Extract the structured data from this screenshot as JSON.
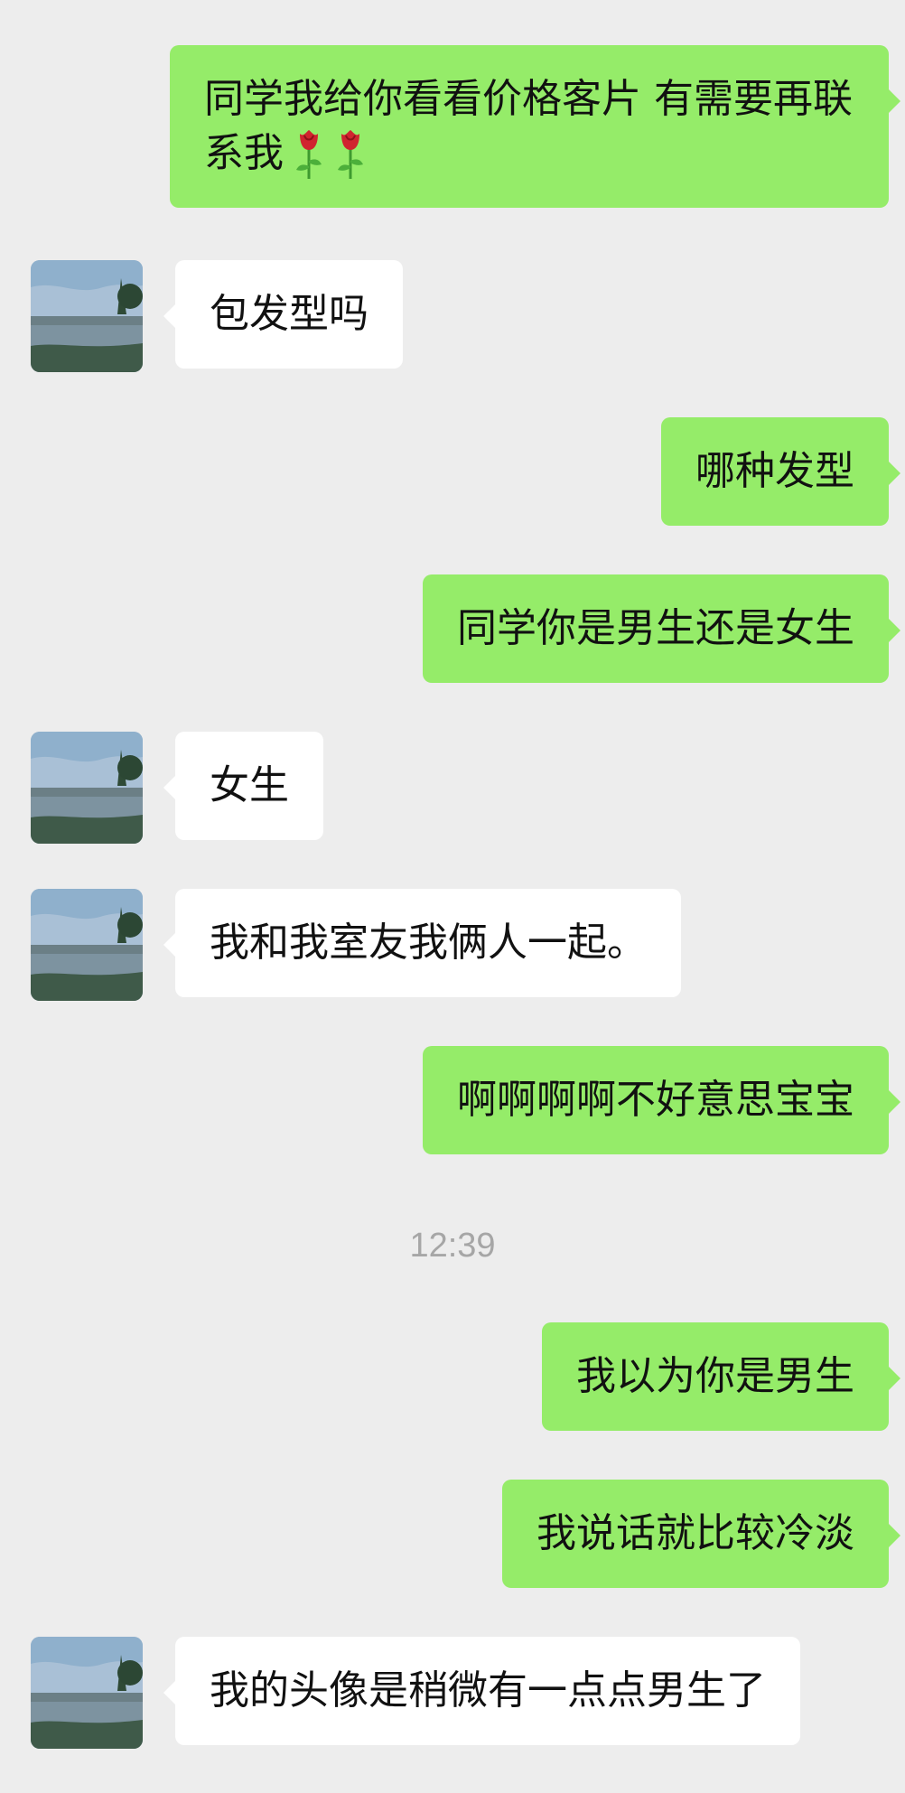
{
  "messages": [
    {
      "side": "right",
      "text": "同学我给你看看价格客片 有需要再联系我",
      "emoji": [
        "rose-icon",
        "rose-icon"
      ]
    },
    {
      "side": "left",
      "text": "包发型吗"
    },
    {
      "side": "right",
      "text": "哪种发型"
    },
    {
      "side": "right",
      "text": "同学你是男生还是女生"
    },
    {
      "side": "left",
      "text": "女生"
    },
    {
      "side": "left",
      "text": "我和我室友我俩人一起。"
    },
    {
      "side": "right",
      "text": "啊啊啊啊不好意思宝宝"
    },
    {
      "side": "right",
      "text": "我以为你是男生"
    },
    {
      "side": "right",
      "text": "我说话就比较冷淡"
    },
    {
      "side": "left",
      "text": "我的头像是稍微有一点点男生了"
    }
  ],
  "timestamp": "12:39",
  "colors": {
    "background": "#ededed",
    "outgoing_bubble": "#95ec69",
    "incoming_bubble": "#ffffff",
    "timestamp_text": "#a6a6a6"
  }
}
